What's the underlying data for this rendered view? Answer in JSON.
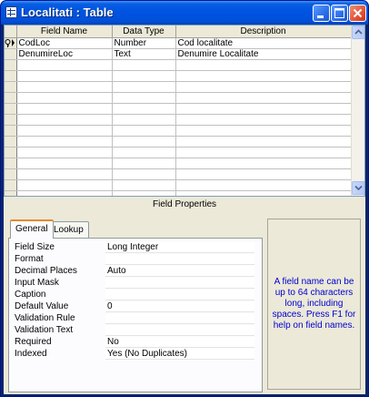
{
  "window": {
    "title": "Localitati : Table"
  },
  "grid": {
    "headers": {
      "field_name": "Field Name",
      "data_type": "Data Type",
      "description": "Description"
    },
    "rows": [
      {
        "field_name": "CodLoc",
        "data_type": "Number",
        "description": "Cod localitate"
      },
      {
        "field_name": "DenumireLoc",
        "data_type": "Text",
        "description": "Denumire Localitate"
      }
    ]
  },
  "field_properties": {
    "label": "Field Properties"
  },
  "tabs": {
    "general": "General",
    "lookup": "Lookup"
  },
  "properties": [
    {
      "name": "Field Size",
      "value": "Long Integer"
    },
    {
      "name": "Format",
      "value": ""
    },
    {
      "name": "Decimal Places",
      "value": "Auto"
    },
    {
      "name": "Input Mask",
      "value": ""
    },
    {
      "name": "Caption",
      "value": ""
    },
    {
      "name": "Default Value",
      "value": "0"
    },
    {
      "name": "Validation Rule",
      "value": ""
    },
    {
      "name": "Validation Text",
      "value": ""
    },
    {
      "name": "Required",
      "value": "No"
    },
    {
      "name": "Indexed",
      "value": "Yes (No Duplicates)"
    }
  ],
  "help_text": "A field name can be up to 64 characters long, including spaces. Press F1 for help on field names."
}
